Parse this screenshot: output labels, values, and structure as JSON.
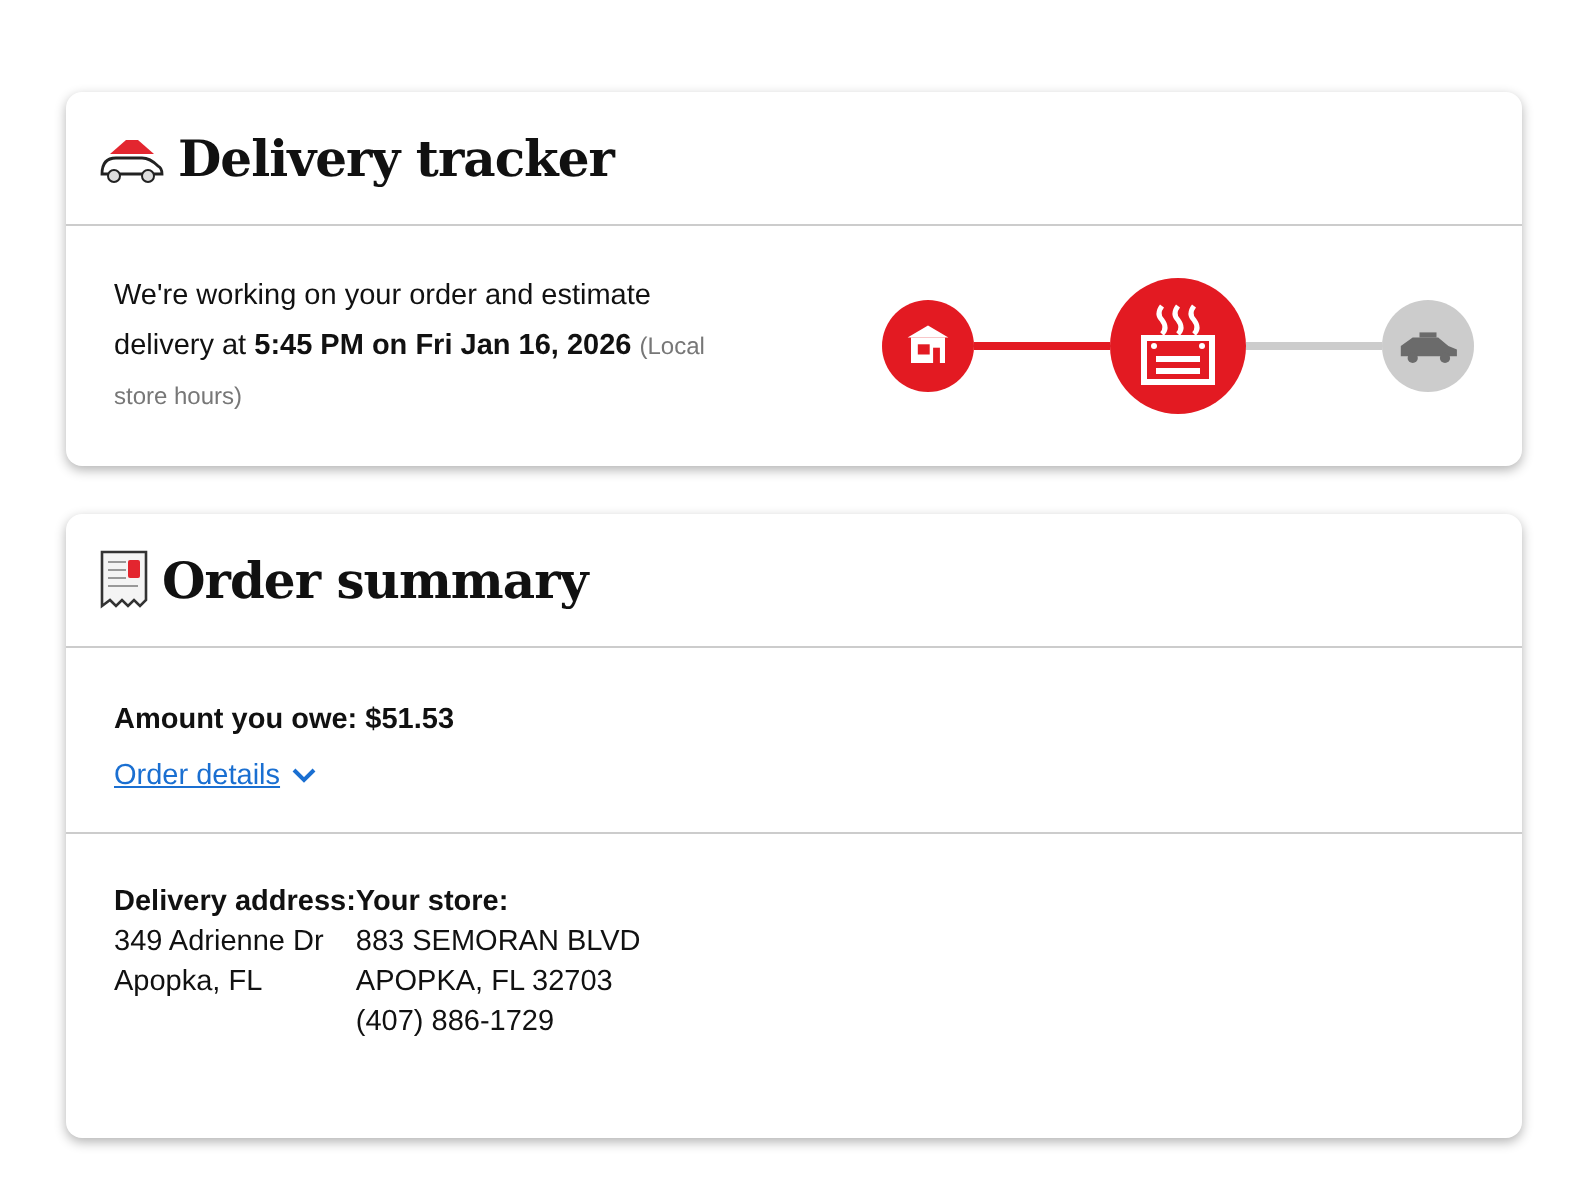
{
  "tracker": {
    "title": "Delivery tracker",
    "message": "We're working on your order and estimate delivery at **5:45 PM on Fri Jan 16, 2026**",
    "note": "(Local store hours)",
    "steps": [
      {
        "kind": "store",
        "done": true,
        "current": false
      },
      {
        "kind": "oven",
        "done": false,
        "current": true
      },
      {
        "kind": "car",
        "done": false,
        "current": false
      }
    ]
  },
  "summary": {
    "title": "Order summary",
    "amount_label": "Amount you owe: $51.53",
    "details_link": "Order details",
    "expanded": false,
    "delivery_address": {
      "label": "Delivery address:",
      "lines": [
        "349 Adrienne Dr",
        "Apopka, FL"
      ]
    },
    "store": {
      "label": "Your store:",
      "lines": [
        "883 SEMORAN BLVD",
        "APOPKA, FL 32703",
        "(407) 886-1729"
      ]
    }
  }
}
